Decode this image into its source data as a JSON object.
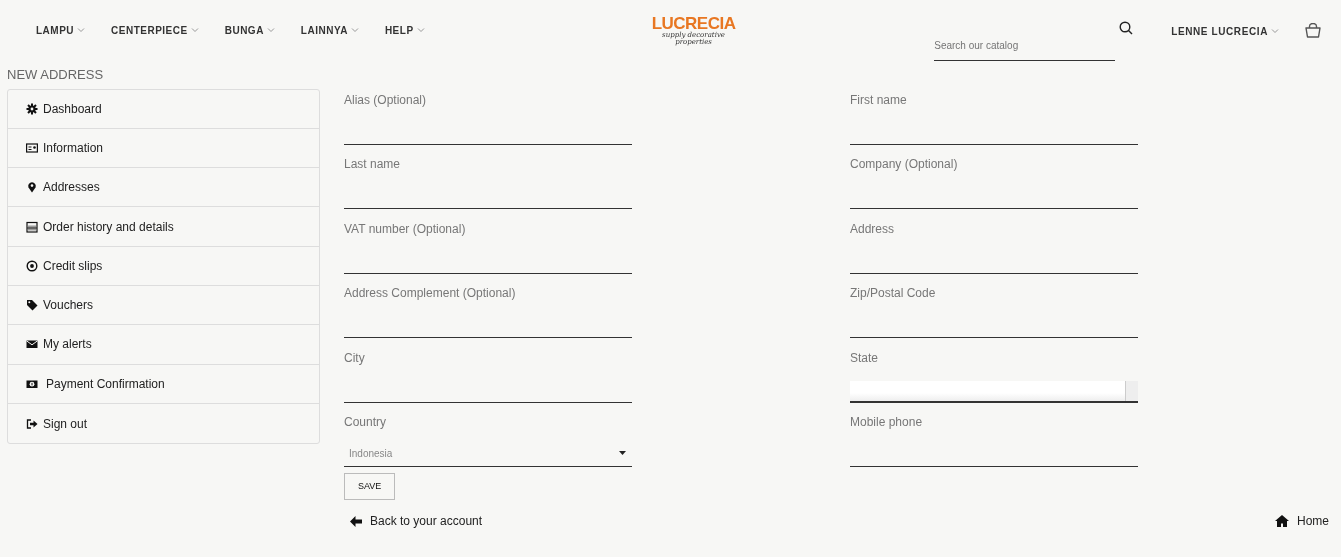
{
  "header": {
    "menu": [
      {
        "label": "LAMPU"
      },
      {
        "label": "CENTERPIECE"
      },
      {
        "label": "BUNGA"
      },
      {
        "label": "LAINNYA"
      },
      {
        "label": "HELP"
      }
    ],
    "logo": {
      "name": "LUCRECIA",
      "tagline": "supply decorative properties"
    },
    "search": {
      "placeholder": "Search our catalog"
    },
    "account": "LENNE LUCRECIA"
  },
  "page_title": "NEW ADDRESS",
  "sidebar": {
    "items": [
      {
        "label": "Dashboard"
      },
      {
        "label": "Information"
      },
      {
        "label": "Addresses"
      },
      {
        "label": "Order history and details"
      },
      {
        "label": "Credit slips"
      },
      {
        "label": "Vouchers"
      },
      {
        "label": "My alerts"
      },
      {
        "label": "Payment Confirmation"
      },
      {
        "label": "Sign out"
      }
    ]
  },
  "form": {
    "fields": [
      {
        "label": "Alias (Optional)",
        "kind": "text"
      },
      {
        "label": "First name",
        "kind": "text"
      },
      {
        "label": "Last name",
        "kind": "text"
      },
      {
        "label": "Company (Optional)",
        "kind": "text"
      },
      {
        "label": "VAT number (Optional)",
        "kind": "text"
      },
      {
        "label": "Address",
        "kind": "text"
      },
      {
        "label": "Address Complement (Optional)",
        "kind": "text"
      },
      {
        "label": "Zip/Postal Code",
        "kind": "text"
      },
      {
        "label": "City",
        "kind": "text"
      },
      {
        "label": "State",
        "kind": "listbox"
      },
      {
        "label": "Country",
        "kind": "select",
        "value": "Indonesia"
      },
      {
        "label": "Mobile phone",
        "kind": "text"
      }
    ],
    "save_button": "SAVE",
    "back_link": "Back to your account"
  },
  "home_link": "Home"
}
